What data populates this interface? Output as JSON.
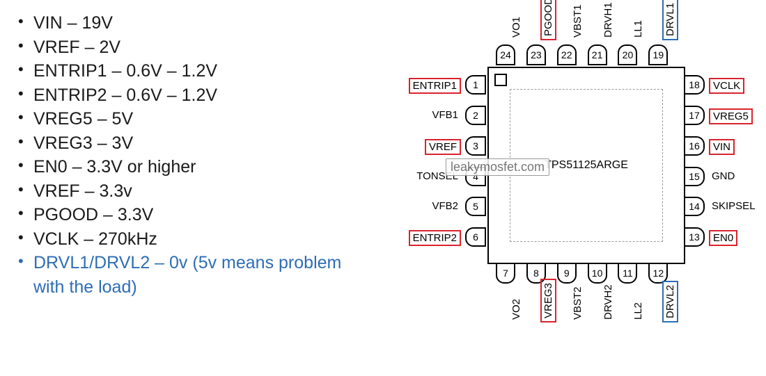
{
  "bullets": [
    {
      "text": "VIN – 19V"
    },
    {
      "text": "VREF – 2V"
    },
    {
      "text": "ENTRIP1 – 0.6V – 1.2V"
    },
    {
      "text": "ENTRIP2 – 0.6V – 1.2V"
    },
    {
      "text": "VREG5 – 5V"
    },
    {
      "text": "VREG3 – 3V"
    },
    {
      "text": "EN0 – 3.3V or higher"
    },
    {
      "text": "VREF – 3.3v"
    },
    {
      "text": "PGOOD – 3.3V"
    },
    {
      "text": "VCLK – 270kHz"
    },
    {
      "text": "DRVL1/DRVL2 – 0v (5v means problem with the load)",
      "highlight": true
    }
  ],
  "chip": {
    "part": "TPS51125ARGE"
  },
  "watermark": "leakymosfet.com",
  "pins": {
    "left": [
      {
        "n": "1",
        "label": "ENTRIP1",
        "hi": "red"
      },
      {
        "n": "2",
        "label": "VFB1"
      },
      {
        "n": "3",
        "label": "VREF",
        "hi": "red"
      },
      {
        "n": "4",
        "label": "TONSEL"
      },
      {
        "n": "5",
        "label": "VFB2"
      },
      {
        "n": "6",
        "label": "ENTRIP2",
        "hi": "red"
      }
    ],
    "bottom": [
      {
        "n": "7",
        "label": "VO2"
      },
      {
        "n": "8",
        "label": "VREG3",
        "hi": "red"
      },
      {
        "n": "9",
        "label": "VBST2"
      },
      {
        "n": "10",
        "label": "DRVH2"
      },
      {
        "n": "11",
        "label": "LL2"
      },
      {
        "n": "12",
        "label": "DRVL2",
        "hi": "blue"
      }
    ],
    "right": [
      {
        "n": "18",
        "label": "VCLK",
        "hi": "red"
      },
      {
        "n": "17",
        "label": "VREG5",
        "hi": "red"
      },
      {
        "n": "16",
        "label": "VIN",
        "hi": "red"
      },
      {
        "n": "15",
        "label": "GND"
      },
      {
        "n": "14",
        "label": "SKIPSEL"
      },
      {
        "n": "13",
        "label": "EN0",
        "hi": "red"
      }
    ],
    "top": [
      {
        "n": "24",
        "label": "VO1"
      },
      {
        "n": "23",
        "label": "PGOOD",
        "hi": "red"
      },
      {
        "n": "22",
        "label": "VBST1"
      },
      {
        "n": "21",
        "label": "DRVH1"
      },
      {
        "n": "20",
        "label": "LL1"
      },
      {
        "n": "19",
        "label": "DRVL1",
        "hi": "blue"
      }
    ]
  }
}
